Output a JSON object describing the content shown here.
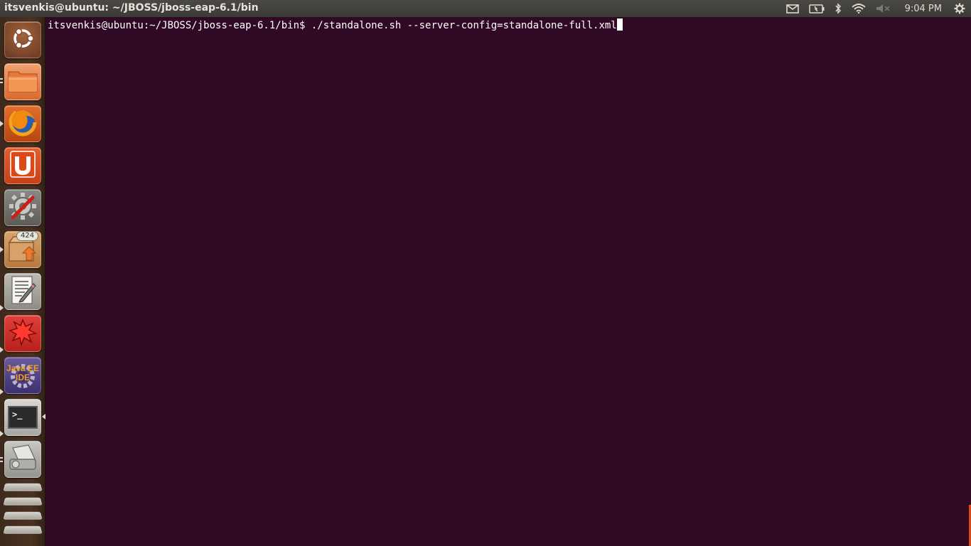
{
  "topbar": {
    "window_title": "itsvenkis@ubuntu: ~/JBOSS/jboss-eap-6.1/bin",
    "clock": "9:04 PM",
    "indicators": [
      "mail-icon",
      "battery-icon",
      "bluetooth-icon",
      "wifi-icon",
      "volume-muted-icon",
      "gear-icon"
    ]
  },
  "launcher": {
    "items": [
      {
        "name": "dash-home",
        "icon": "ubuntu-logo-icon"
      },
      {
        "name": "files",
        "icon": "folder-icon"
      },
      {
        "name": "firefox",
        "icon": "firefox-icon"
      },
      {
        "name": "ubuntu-one",
        "icon": "ubuntu-one-icon",
        "label": "U"
      },
      {
        "name": "system-settings",
        "icon": "settings-wrench-icon"
      },
      {
        "name": "software-updater",
        "icon": "update-icon",
        "badge": "424"
      },
      {
        "name": "text-editor",
        "icon": "text-editor-icon"
      },
      {
        "name": "crash-reporter",
        "icon": "crash-icon"
      },
      {
        "name": "eclipse-java-ee",
        "icon": "java-ee-ide-icon",
        "label_line1": "Java EE",
        "label_line2": "IDE"
      },
      {
        "name": "terminal",
        "icon": "terminal-icon",
        "label": ">_"
      },
      {
        "name": "scanner",
        "icon": "scanner-icon"
      },
      {
        "name": "workspaces-and-trash",
        "icon": "trash-icon"
      }
    ]
  },
  "terminal": {
    "prompt": "itsvenkis@ubuntu:~/JBOSS/jboss-eap-6.1/bin$",
    "command": " ./standalone.sh --server-config=standalone-full.xml"
  },
  "colors": {
    "terminal_bg": "#300a24",
    "topbar_bg": "#3c3b37",
    "accent": "#dd4814"
  }
}
